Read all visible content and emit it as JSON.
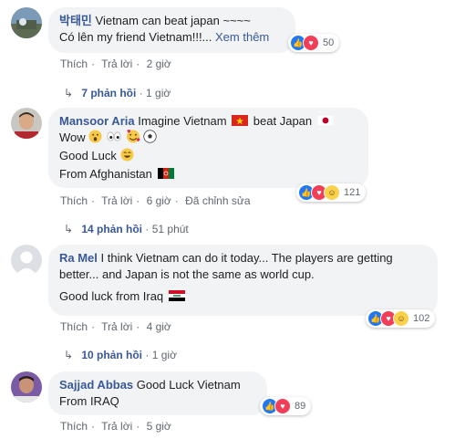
{
  "comments": [
    {
      "author": "박태민",
      "text_line1": "Vietnam can beat japan ~~~~",
      "text_line2": "Có lên my friend Vietnam!!!...",
      "see_more": "Xem thêm",
      "reaction_count": "50",
      "actions": {
        "like": "Thích",
        "reply": "Trả lời",
        "time": "2 giờ"
      },
      "replies": {
        "count": "7 phản hồi",
        "time": "1 giờ"
      }
    },
    {
      "author": "Mansoor Aria",
      "text_line1_a": "Imagine Vietnam",
      "text_line1_b": "beat Japan",
      "text_line2": "Wow",
      "text_line3": "Good Luck",
      "text_line4": "From Afghanistan",
      "reaction_count": "121",
      "actions": {
        "like": "Thích",
        "reply": "Trả lời",
        "time": "6 giờ",
        "edited": "Đã chỉnh sửa"
      },
      "replies": {
        "count": "14 phản hồi",
        "time": "51 phút"
      }
    },
    {
      "author": "Ra Mel",
      "text_line1": "I think Vietnam can do it today... The players are getting",
      "text_line2": "better... and Japan is not the same as world cup.",
      "text_line3": "Good luck from Iraq",
      "reaction_count": "102",
      "actions": {
        "like": "Thích",
        "reply": "Trả lời",
        "time": "4 giờ"
      },
      "replies": {
        "count": "10 phản hồi",
        "time": "1 giờ"
      }
    },
    {
      "author": "Sajjad Abbas",
      "text_line1": "Good Luck Vietnam",
      "text_line2": "From IRAQ",
      "reaction_count": "89",
      "actions": {
        "like": "Thích",
        "reply": "Trả lời",
        "time": "5 giờ"
      }
    }
  ]
}
